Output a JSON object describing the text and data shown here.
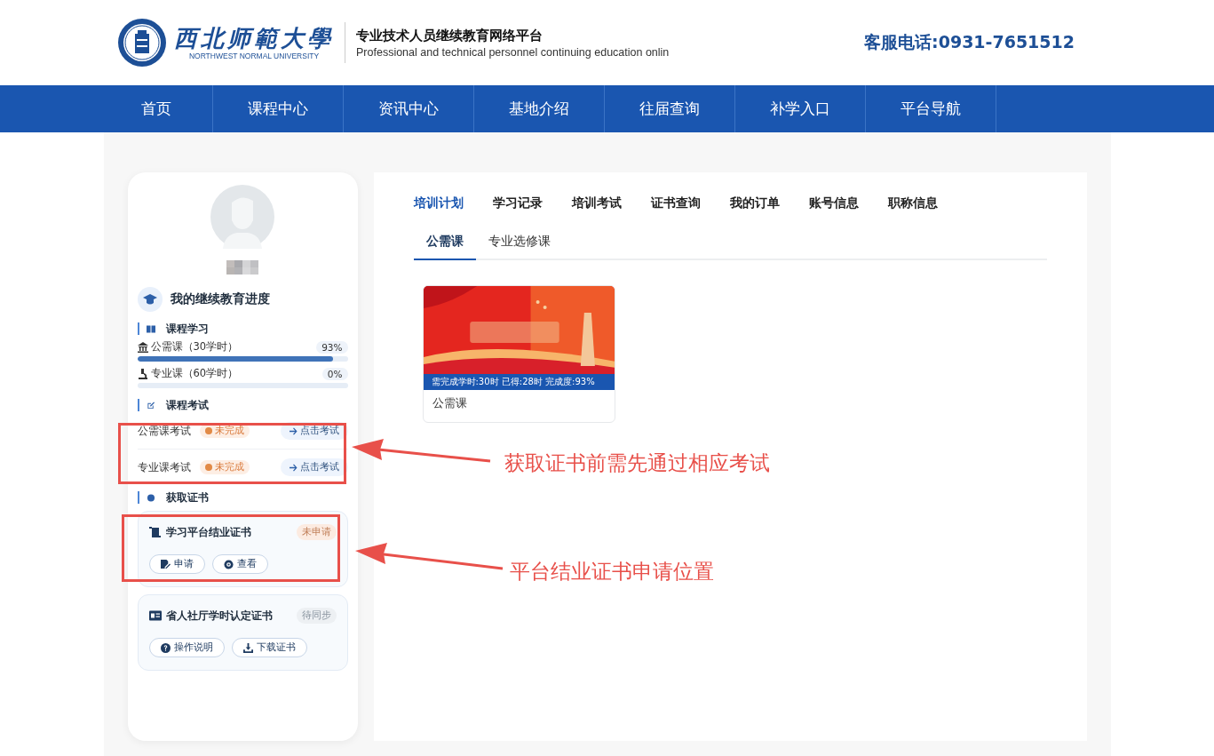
{
  "header": {
    "logo_cn": "西北师範大學",
    "logo_en": "NORTHWEST NORMAL UNIVERSITY",
    "title": "专业技术人员继续教育网络平台",
    "subtitle": "Professional and technical personnel continuing education onlin",
    "hotline": "客服电话:0931-7651512"
  },
  "nav": [
    {
      "label": "首页"
    },
    {
      "label": "课程中心"
    },
    {
      "label": "资讯中心"
    },
    {
      "label": "基地介绍"
    },
    {
      "label": "往届查询"
    },
    {
      "label": "补学入口"
    },
    {
      "label": "平台导航"
    }
  ],
  "sidebar": {
    "heading": "我的继续教育进度",
    "study": {
      "title": "课程学习",
      "items": [
        {
          "kind": "public",
          "label": "公需课（30学时）",
          "reading": "93%",
          "level": 0.93
        },
        {
          "kind": "major",
          "label": "专业课（60学时）",
          "reading": "0%"
        }
      ]
    },
    "exams": {
      "title": "课程考试",
      "items": [
        {
          "label": "公需课考试",
          "status": "未完成",
          "action": "点击考试"
        },
        {
          "label": "专业课考试",
          "status": "未完成",
          "action": "点击考试"
        }
      ]
    },
    "certificates": {
      "title": "获取证书",
      "items": [
        {
          "kind": "platform",
          "title": "学习平台结业证书",
          "status": "未申请",
          "color": "#fcebe1",
          "buttons": [
            {
              "kind": "apply",
              "label": "申请"
            },
            {
              "kind": "view",
              "label": "查看"
            }
          ]
        },
        {
          "kind": "province",
          "title": "省人社厅学时认定证书",
          "status": "待同步",
          "color": "#edf0f3",
          "buttons": [
            {
              "kind": "help",
              "label": "操作说明"
            },
            {
              "kind": "download",
              "label": "下载证书"
            }
          ]
        }
      ]
    }
  },
  "tabs": [
    {
      "label": "培训计划",
      "selected": true
    },
    {
      "label": "学习记录",
      "selected": false
    },
    {
      "label": "培训考试",
      "selected": false
    },
    {
      "label": "证书查询",
      "selected": false
    },
    {
      "label": "我的订单",
      "selected": false
    },
    {
      "label": "账号信息",
      "selected": false
    },
    {
      "label": "职称信息",
      "selected": false
    }
  ],
  "subtabs": [
    {
      "label": "公需课",
      "selected": true
    },
    {
      "label": "专业选修课",
      "selected": false
    }
  ],
  "courses": [
    {
      "kind": "picture",
      "caption": "需完成学时:30时 已得:28时 完成度:93%",
      "title": "公需课"
    }
  ],
  "annotations": [
    {
      "text": "获取证书前需先通过相应考试"
    },
    {
      "text": "平台结业证书申请位置"
    }
  ]
}
